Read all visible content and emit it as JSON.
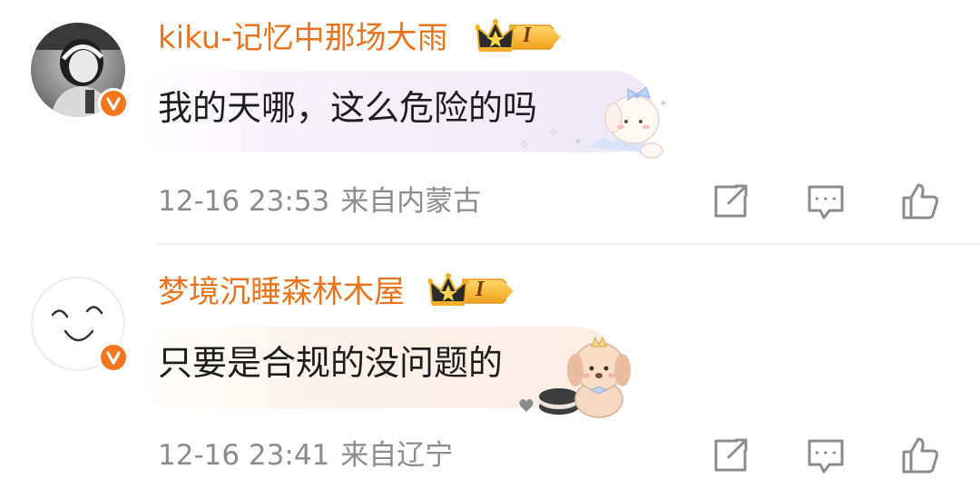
{
  "comments": [
    {
      "username": "kiku-记忆中那场大雨",
      "text": "我的天哪，这么危险的吗",
      "time": "12-16 23:53",
      "location": "来自内蒙古",
      "badge_level": "I",
      "colors": {
        "username": "#e8741e",
        "bubble": "#efe8f6"
      },
      "avatar_icon": "girl-photo-avatar",
      "sticker_icon": "bunny-bow-sticker"
    },
    {
      "username": "梦境沉睡森林木屋",
      "text": "只要是合规的没问题的",
      "time": "12-16 23:41",
      "location": "来自辽宁",
      "badge_level": "I",
      "colors": {
        "username": "#e8741e",
        "bubble": "#fbede4"
      },
      "avatar_icon": "smiley-face-avatar",
      "sticker_icon": "puppy-cookie-sticker"
    }
  ],
  "icons": {
    "share": "share-icon",
    "comment": "comment-icon",
    "like": "thumbs-up-icon",
    "verified": "verified-v-icon",
    "crown": "crown-icon"
  },
  "accent_color": "#f2771e"
}
